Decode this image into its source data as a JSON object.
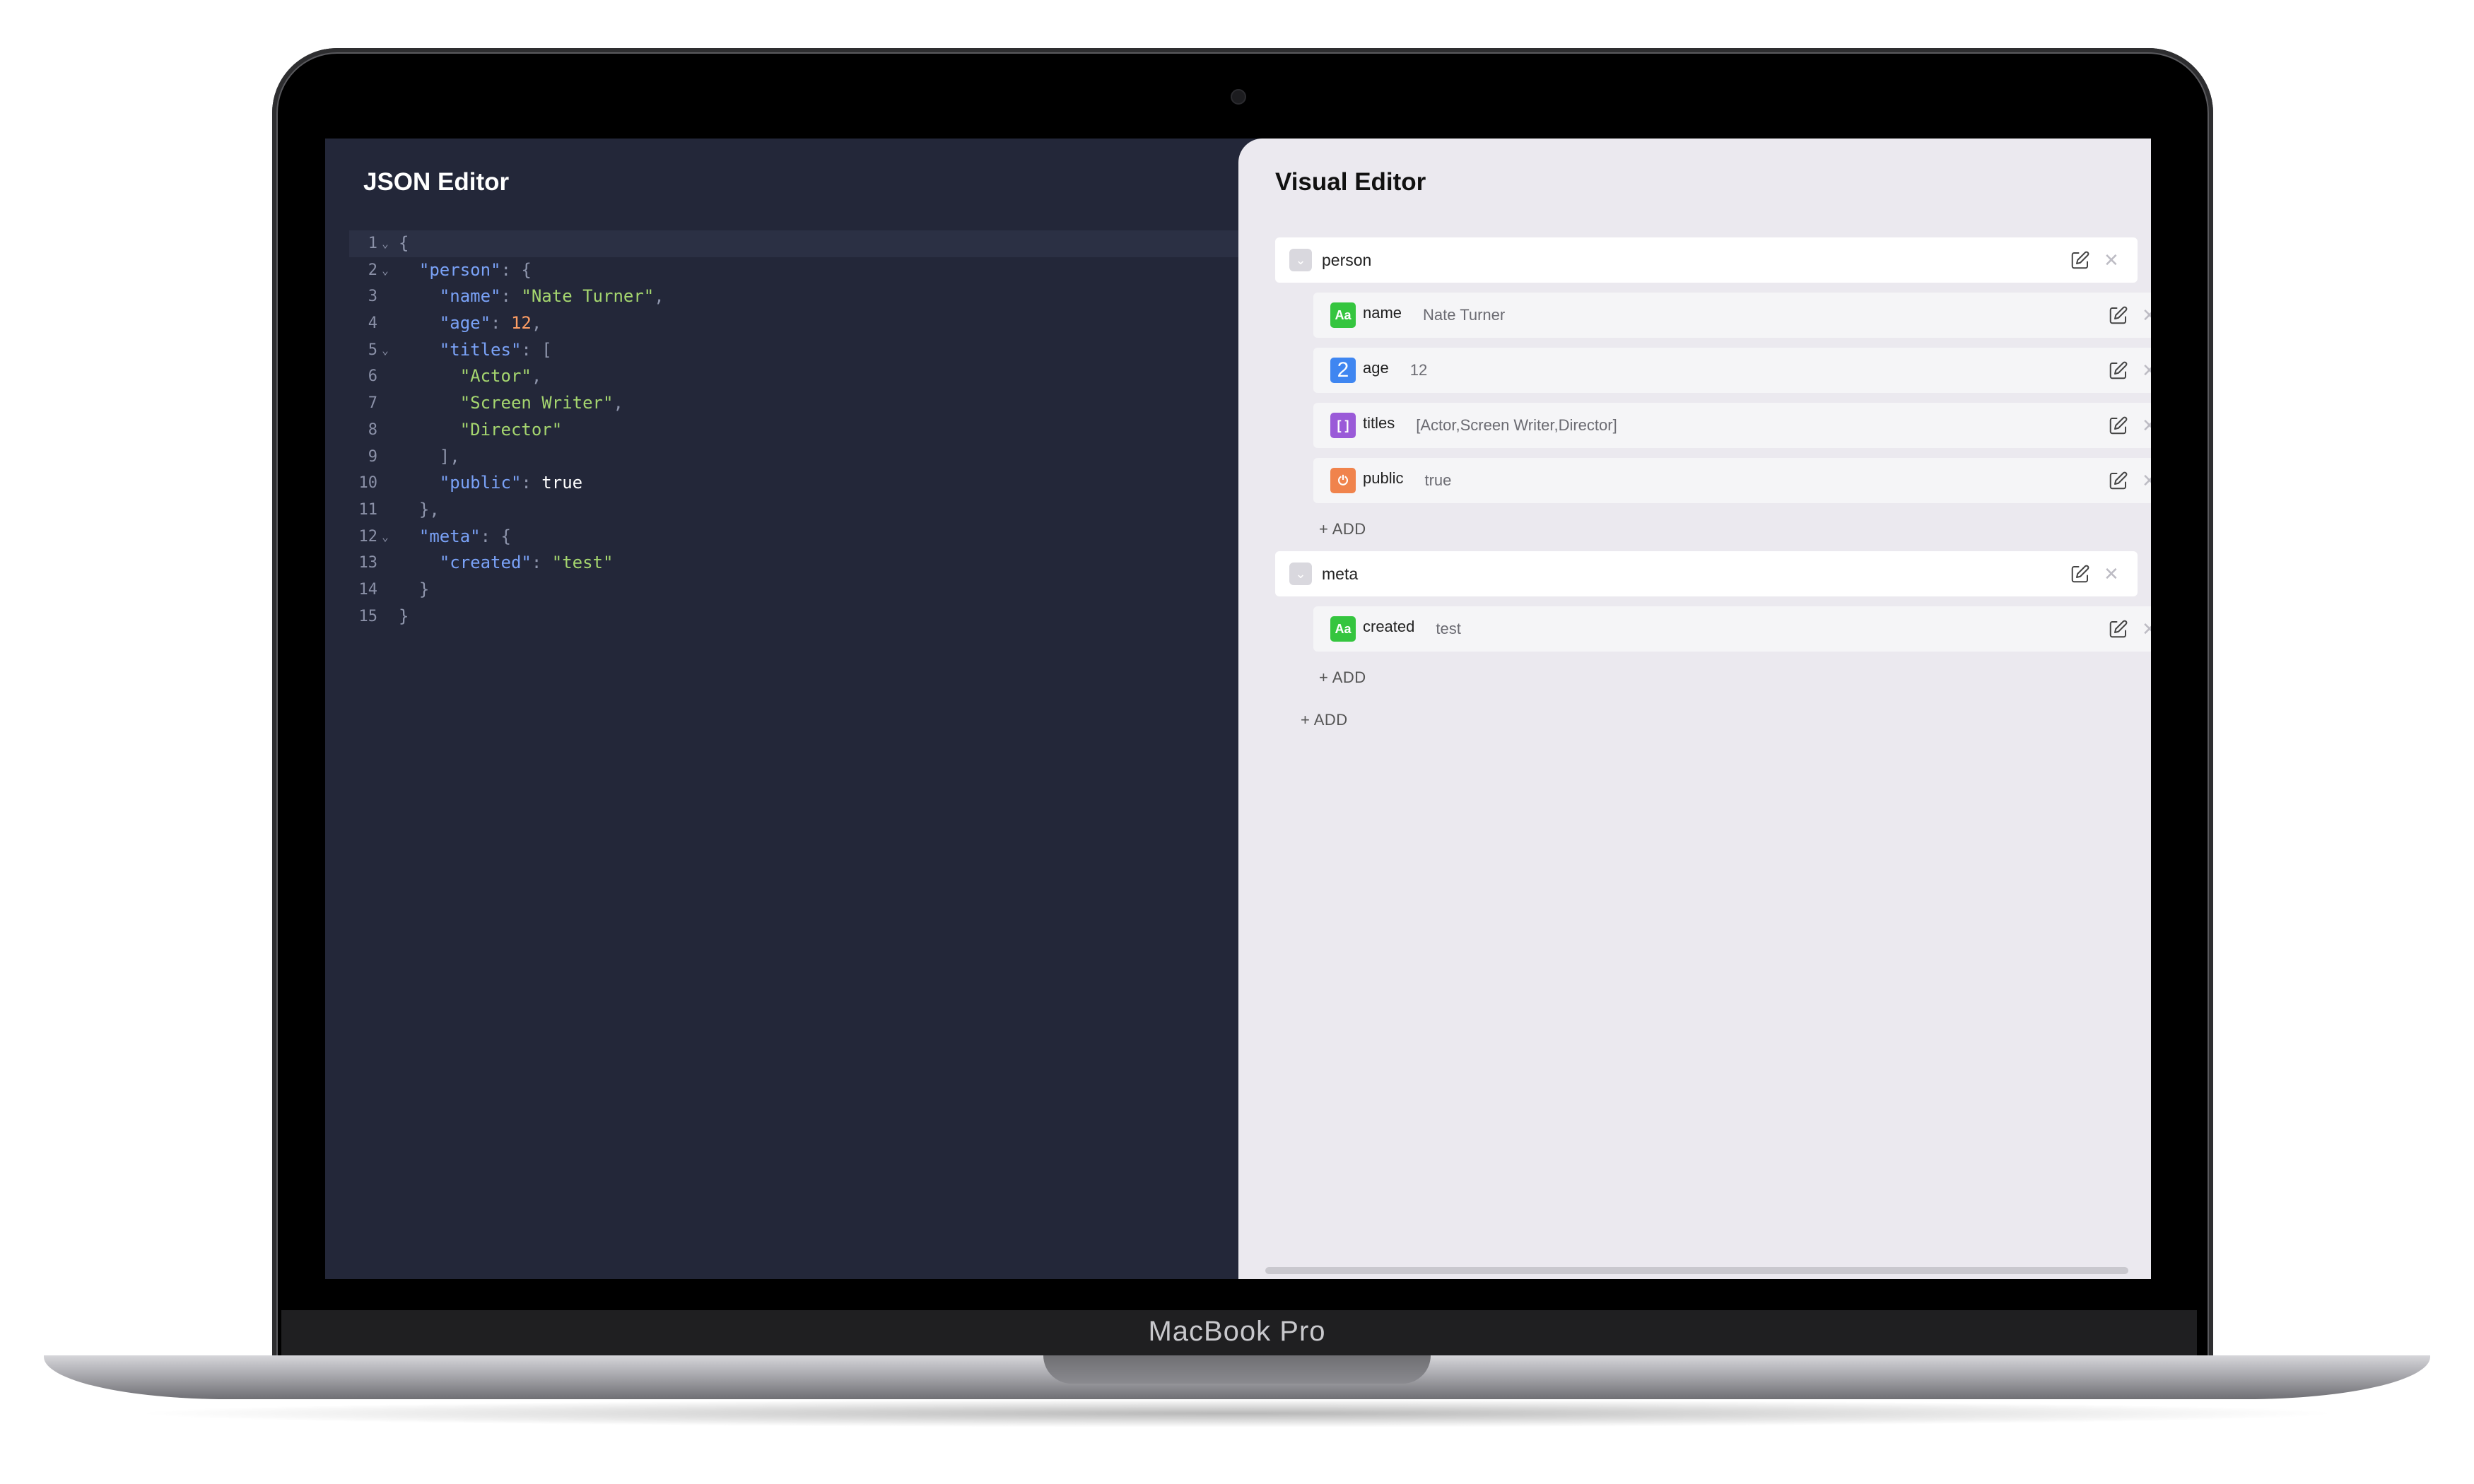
{
  "device": {
    "brand_label": "MacBook Pro"
  },
  "json_editor": {
    "title": "JSON Editor",
    "lines": [
      {
        "n": "1",
        "fold": true,
        "tokens": [
          {
            "t": "punct",
            "v": "{"
          }
        ]
      },
      {
        "n": "2",
        "fold": true,
        "tokens": [
          {
            "t": "ws",
            "v": "  "
          },
          {
            "t": "key",
            "v": "\"person\""
          },
          {
            "t": "punct",
            "v": ": {"
          }
        ]
      },
      {
        "n": "3",
        "fold": false,
        "tokens": [
          {
            "t": "ws",
            "v": "    "
          },
          {
            "t": "key",
            "v": "\"name\""
          },
          {
            "t": "punct",
            "v": ": "
          },
          {
            "t": "str",
            "v": "\"Nate Turner\""
          },
          {
            "t": "punct",
            "v": ","
          }
        ]
      },
      {
        "n": "4",
        "fold": false,
        "tokens": [
          {
            "t": "ws",
            "v": "    "
          },
          {
            "t": "key",
            "v": "\"age\""
          },
          {
            "t": "punct",
            "v": ": "
          },
          {
            "t": "num",
            "v": "12"
          },
          {
            "t": "punct",
            "v": ","
          }
        ]
      },
      {
        "n": "5",
        "fold": true,
        "tokens": [
          {
            "t": "ws",
            "v": "    "
          },
          {
            "t": "key",
            "v": "\"titles\""
          },
          {
            "t": "punct",
            "v": ": ["
          }
        ]
      },
      {
        "n": "6",
        "fold": false,
        "tokens": [
          {
            "t": "ws",
            "v": "      "
          },
          {
            "t": "str",
            "v": "\"Actor\""
          },
          {
            "t": "punct",
            "v": ","
          }
        ]
      },
      {
        "n": "7",
        "fold": false,
        "tokens": [
          {
            "t": "ws",
            "v": "      "
          },
          {
            "t": "str",
            "v": "\"Screen Writer\""
          },
          {
            "t": "punct",
            "v": ","
          }
        ]
      },
      {
        "n": "8",
        "fold": false,
        "tokens": [
          {
            "t": "ws",
            "v": "      "
          },
          {
            "t": "str",
            "v": "\"Director\""
          }
        ]
      },
      {
        "n": "9",
        "fold": false,
        "tokens": [
          {
            "t": "ws",
            "v": "    "
          },
          {
            "t": "punct",
            "v": "],"
          }
        ]
      },
      {
        "n": "10",
        "fold": false,
        "tokens": [
          {
            "t": "ws",
            "v": "    "
          },
          {
            "t": "key",
            "v": "\"public\""
          },
          {
            "t": "punct",
            "v": ": "
          },
          {
            "t": "bool",
            "v": "true"
          }
        ]
      },
      {
        "n": "11",
        "fold": false,
        "tokens": [
          {
            "t": "ws",
            "v": "  "
          },
          {
            "t": "punct",
            "v": "},"
          }
        ]
      },
      {
        "n": "12",
        "fold": true,
        "tokens": [
          {
            "t": "ws",
            "v": "  "
          },
          {
            "t": "key",
            "v": "\"meta\""
          },
          {
            "t": "punct",
            "v": ": {"
          }
        ]
      },
      {
        "n": "13",
        "fold": false,
        "tokens": [
          {
            "t": "ws",
            "v": "    "
          },
          {
            "t": "key",
            "v": "\"created\""
          },
          {
            "t": "punct",
            "v": ": "
          },
          {
            "t": "str",
            "v": "\"test\""
          }
        ]
      },
      {
        "n": "14",
        "fold": false,
        "tokens": [
          {
            "t": "ws",
            "v": "  "
          },
          {
            "t": "punct",
            "v": "}"
          }
        ]
      },
      {
        "n": "15",
        "fold": false,
        "tokens": [
          {
            "t": "punct",
            "v": "}"
          }
        ]
      }
    ]
  },
  "visual_editor": {
    "title": "Visual Editor",
    "add_label": "+ ADD",
    "objects": [
      {
        "key": "person",
        "fields": [
          {
            "key": "name",
            "value": "Nate Turner",
            "type": "string",
            "badge": "Aa",
            "icon": "string-type-icon"
          },
          {
            "key": "age",
            "value": "12",
            "type": "number",
            "badge": "2",
            "icon": "number-type-icon"
          },
          {
            "key": "titles",
            "value": "[Actor,Screen Writer,Director]",
            "type": "array",
            "badge": "[ ]",
            "icon": "array-type-icon"
          },
          {
            "key": "public",
            "value": "true",
            "type": "boolean",
            "badge": "⏻",
            "icon": "boolean-type-icon"
          }
        ]
      },
      {
        "key": "meta",
        "fields": [
          {
            "key": "created",
            "value": "test",
            "type": "string",
            "badge": "Aa",
            "icon": "string-type-icon"
          }
        ]
      }
    ],
    "colors": {
      "string": "#35c53f",
      "number": "#3f86f1",
      "array": "#9a5ad8",
      "boolean": "#f0834c"
    }
  }
}
